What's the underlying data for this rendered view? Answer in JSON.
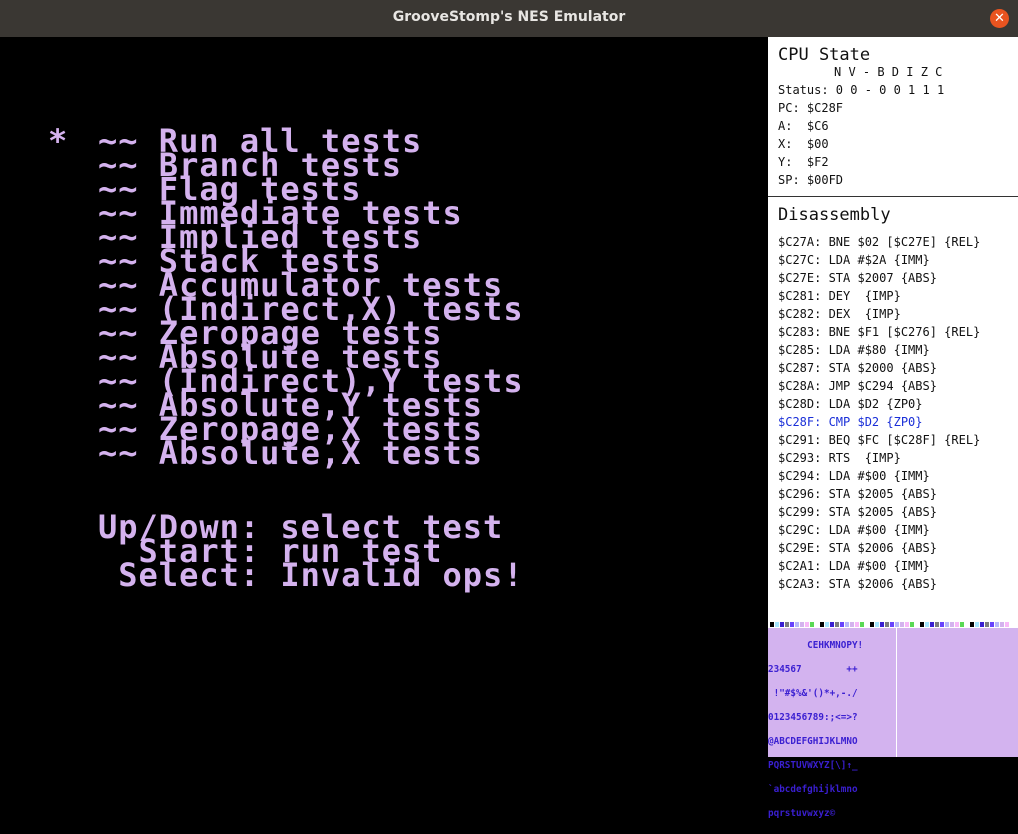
{
  "window": {
    "title": "GrooveStomp's NES Emulator"
  },
  "screen": {
    "menu": [
      {
        "cursor": "*",
        "text": "~~ Run all tests"
      },
      {
        "cursor": "",
        "text": "~~ Branch tests"
      },
      {
        "cursor": "",
        "text": "~~ Flag tests"
      },
      {
        "cursor": "",
        "text": "~~ Immediate tests"
      },
      {
        "cursor": "",
        "text": "~~ Implied tests"
      },
      {
        "cursor": "",
        "text": "~~ Stack tests"
      },
      {
        "cursor": "",
        "text": "~~ Accumulator tests"
      },
      {
        "cursor": "",
        "text": "~~ (Indirect,X) tests"
      },
      {
        "cursor": "",
        "text": "~~ Zeropage tests"
      },
      {
        "cursor": "",
        "text": "~~ Absolute tests"
      },
      {
        "cursor": "",
        "text": "~~ (Indirect),Y tests"
      },
      {
        "cursor": "",
        "text": "~~ Absolute,Y tests"
      },
      {
        "cursor": "",
        "text": "~~ Zeropage,X tests"
      },
      {
        "cursor": "",
        "text": "~~ Absolute,X tests"
      }
    ],
    "help": [
      "Up/Down: select test",
      "  Start: run test",
      " Select: Invalid ops!"
    ]
  },
  "cpu": {
    "heading": "CPU State",
    "flags_header": "N V - B D I Z C",
    "status": "Status: 0 0 - 0 0 1 1 1",
    "pc": "PC: $C28F",
    "a": "A:  $C6",
    "x": "X:  $00",
    "y": "Y:  $F2",
    "sp": "SP: $00FD"
  },
  "disassembly": {
    "heading": "Disassembly",
    "current_index": 11,
    "lines": [
      "$C27A: BNE $02 [$C27E] {REL}",
      "$C27C: LDA #$2A {IMM}",
      "$C27E: STA $2007 {ABS}",
      "$C281: DEY  {IMP}",
      "$C282: DEX  {IMP}",
      "$C283: BNE $F1 [$C276] {REL}",
      "$C285: LDA #$80 {IMM}",
      "$C287: STA $2000 {ABS}",
      "$C28A: JMP $C294 {ABS}",
      "$C28D: LDA $D2 {ZP0}",
      "$C28F: CMP $D2 {ZP0}",
      "$C291: BEQ $FC [$C28F] {REL}",
      "$C293: RTS  {IMP}",
      "$C294: LDA #$00 {IMM}",
      "$C296: STA $2005 {ABS}",
      "$C299: STA $2005 {ABS}",
      "$C29C: LDA #$00 {IMM}",
      "$C29E: STA $2006 {ABS}",
      "$C2A1: LDA #$00 {IMM}",
      "$C2A3: STA $2006 {ABS}"
    ]
  },
  "pattern_table": {
    "rows": [
      "       CEHKMNOPY!",
      "234567        ++",
      " !\"#$%&'()*+,-./",
      "0123456789:;<=>?",
      "@ABCDEFGHIJKLMNO",
      "PQRSTUVWXYZ[\\]↑_",
      "`abcdefghijklmno",
      "pqrstuvwxyz©"
    ]
  },
  "palette_colors": [
    "#000",
    "#7c7c7c",
    "#d4b2ee",
    "#fff",
    "#3a1fd1",
    "#b8b8f8",
    "#58d854",
    "#a4e4fc",
    "#6844fc",
    "#f8b8f8"
  ]
}
